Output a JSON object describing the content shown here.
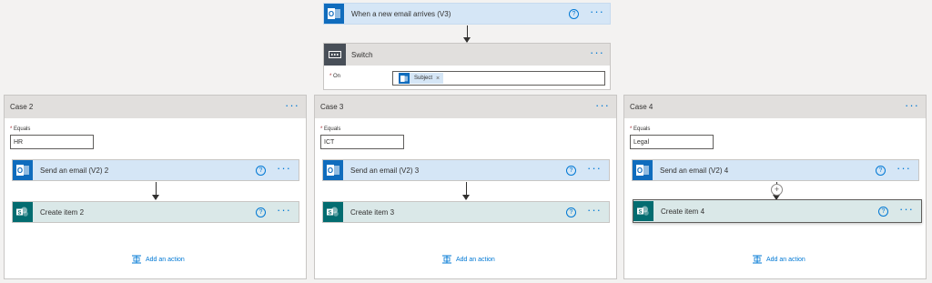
{
  "trigger": {
    "title": "When a new email arrives (V3)",
    "icon": "outlook-icon"
  },
  "switch": {
    "title": "Switch",
    "on_label": "On",
    "token_label": "Subject",
    "token_close": "×"
  },
  "cases": [
    {
      "title": "Case 2",
      "equals_label": "Equals",
      "equals_value": "HR",
      "email_action": "Send an email (V2) 2",
      "create_action": "Create item 2",
      "add_action": "Add an action"
    },
    {
      "title": "Case 3",
      "equals_label": "Equals",
      "equals_value": "ICT",
      "email_action": "Send an email (V2) 3",
      "create_action": "Create item 3",
      "add_action": "Add an action"
    },
    {
      "title": "Case 4",
      "equals_label": "Equals",
      "equals_value": "Legal",
      "email_action": "Send an email (V2) 4",
      "create_action": "Create item 4",
      "add_action": "Add an action"
    }
  ],
  "common": {
    "help_glyph": "?",
    "more_glyph": "···",
    "required_mark": "*",
    "insert_glyph": "+"
  },
  "colors": {
    "outlook": "#0f6cbd",
    "sharepoint": "#036c70",
    "accent": "#0078d4",
    "canvas": "#f3f2f1"
  }
}
